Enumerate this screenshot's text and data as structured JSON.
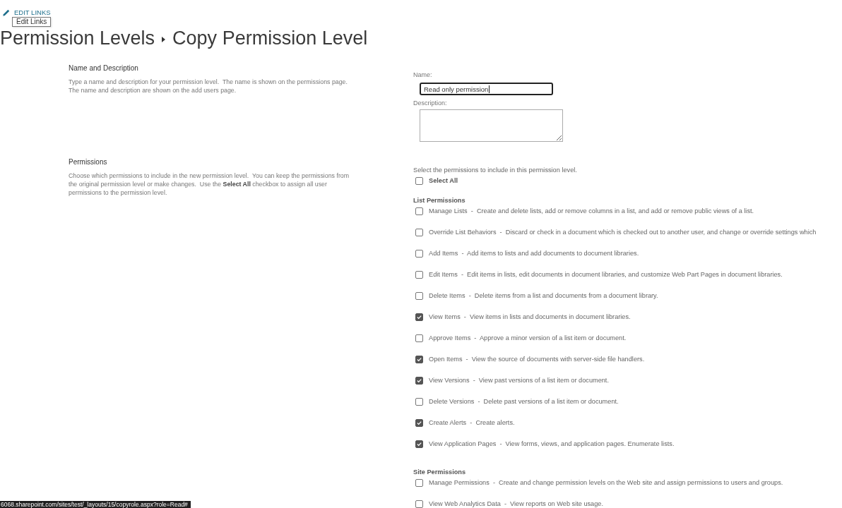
{
  "header": {
    "edit_links": "EDIT LINKS",
    "tooltip": "Edit Links"
  },
  "breadcrumb": [
    {
      "label": "Permission Levels"
    },
    {
      "label": "Copy Permission Level"
    }
  ],
  "sections": [
    {
      "kind": "name_description",
      "title": "Name and Description",
      "description": "Type a name and description for your permission level.  The name is shown on the permissions page. The name and description are shown on the add users page.",
      "name_field": {
        "label": "Name:",
        "value": "Read only permission",
        "focused": true
      },
      "description_field": {
        "label": "Description:"
      }
    },
    {
      "kind": "permissions",
      "title": "Permissions",
      "description": "Choose which permissions to include in the new permission level.  You can keep the permissions from the original permission level or make changes.  Use the **Select All** checkbox to assign all user permissions to the permission level.",
      "intro": "Select the permissions to include in this permission level.",
      "select_all": {
        "label": "Select All",
        "checked": false
      },
      "groups": [
        {
          "title": "List Permissions",
          "items": [
            {
              "label": "Manage Lists  -  Create and delete lists, add or remove columns in a list, and add or remove public views of a list.",
              "checked": false
            },
            {
              "label": "Override List Behaviors  -  Discard or check in a document which is checked out to another user, and change or override settings which",
              "checked": false
            },
            {
              "label": "Add Items  -  Add items to lists and add documents to document libraries.",
              "checked": false
            },
            {
              "label": "Edit Items  -  Edit items in lists, edit documents in document libraries, and customize Web Part Pages in document libraries.",
              "checked": false
            },
            {
              "label": "Delete Items  -  Delete items from a list and documents from a document library.",
              "checked": false
            },
            {
              "label": "View Items  -  View items in lists and documents in document libraries.",
              "checked": true
            },
            {
              "label": "Approve Items  -  Approve a minor version of a list item or document.",
              "checked": false
            },
            {
              "label": "Open Items  -  View the source of documents with server-side file handlers.",
              "checked": true
            },
            {
              "label": "View Versions  -  View past versions of a list item or document.",
              "checked": true
            },
            {
              "label": "Delete Versions  -  Delete past versions of a list item or document.",
              "checked": false
            },
            {
              "label": "Create Alerts  -  Create alerts.",
              "checked": true
            },
            {
              "label": "View Application Pages  -  View forms, views, and application pages. Enumerate lists.",
              "checked": true
            }
          ]
        },
        {
          "title": "Site Permissions",
          "items": [
            {
              "label": "Manage Permissions  -  Create and change permission levels on the Web site and assign permissions to users and groups.",
              "checked": false
            },
            {
              "label": "View Web Analytics Data  -  View reports on Web site usage.",
              "checked": false
            }
          ]
        }
      ]
    }
  ],
  "status_bar": {
    "url": "6068.sharepoint.com/sites/test/_layouts/15/copyrole.aspx?role=Read#"
  }
}
